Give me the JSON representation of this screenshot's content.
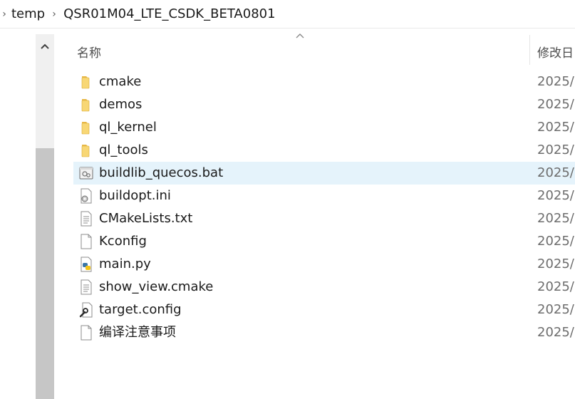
{
  "breadcrumb": {
    "items": [
      "temp",
      "QSR01M04_LTE_CSDK_BETA0801"
    ]
  },
  "header": {
    "name_label": "名称",
    "date_label": "修改日"
  },
  "files": [
    {
      "name": "cmake",
      "date": "2025/",
      "icon": "folder-icon"
    },
    {
      "name": "demos",
      "date": "2025/",
      "icon": "folder-icon"
    },
    {
      "name": "ql_kernel",
      "date": "2025/",
      "icon": "folder-icon"
    },
    {
      "name": "ql_tools",
      "date": "2025/",
      "icon": "folder-icon"
    },
    {
      "name": "buildlib_quecos.bat",
      "date": "2025/",
      "icon": "batch-file-icon",
      "selected": true
    },
    {
      "name": "buildopt.ini",
      "date": "2025/",
      "icon": "config-settings-icon"
    },
    {
      "name": "CMakeLists.txt",
      "date": "2025/",
      "icon": "text-file-icon"
    },
    {
      "name": "Kconfig",
      "date": "2025/",
      "icon": "blank-file-icon"
    },
    {
      "name": "main.py",
      "date": "2025/",
      "icon": "python-file-icon"
    },
    {
      "name": "show_view.cmake",
      "date": "2025/",
      "icon": "text-file-icon"
    },
    {
      "name": "target.config",
      "date": "2025/",
      "icon": "config-file-icon"
    },
    {
      "name": "编译注意事项",
      "date": "2025/",
      "icon": "blank-file-icon"
    }
  ],
  "colors": {
    "selected_row": "#e5f3fb",
    "folder": "#f8d775",
    "scrollbar_thumb": "#c6c6c6"
  }
}
